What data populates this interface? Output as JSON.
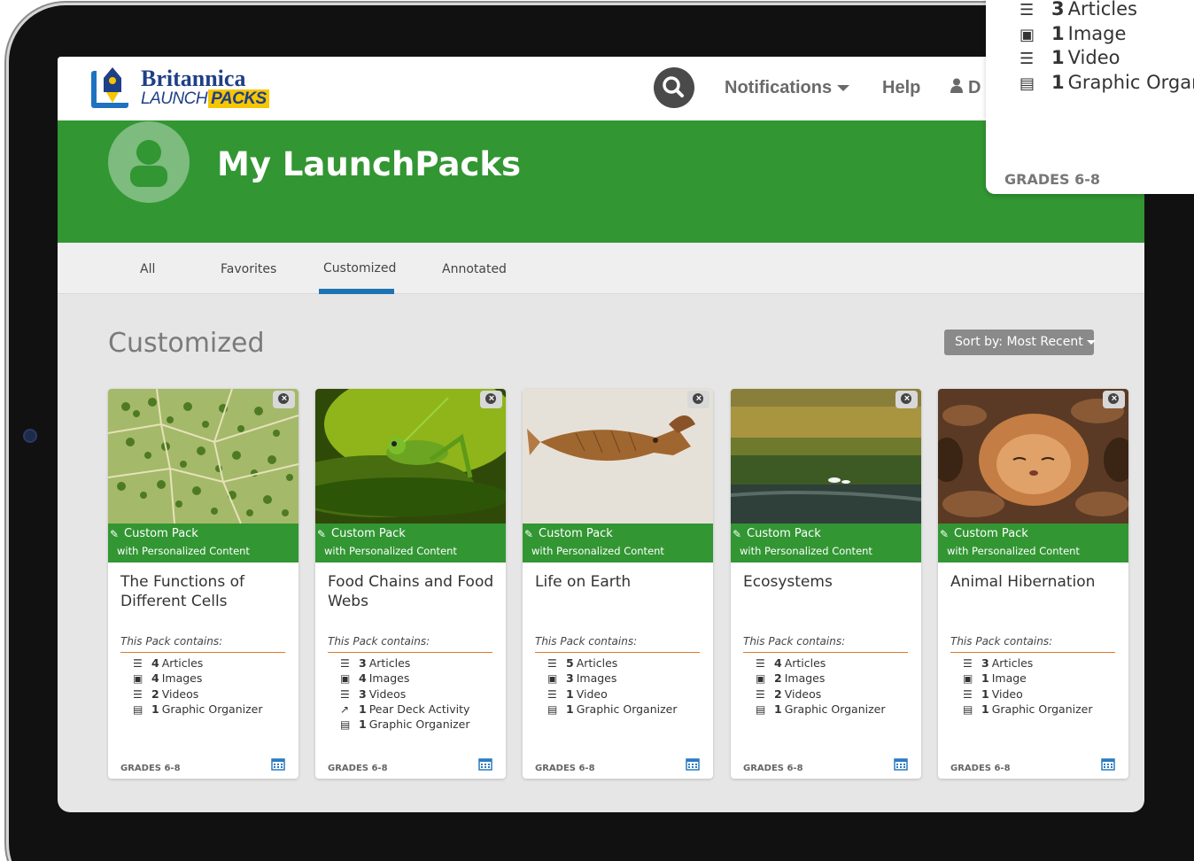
{
  "logo": {
    "line1": "Britannica",
    "line2a": "LAUNCH",
    "line2b": "PACKS"
  },
  "header": {
    "notifications_label": "Notifications",
    "help_label": "Help",
    "user_label": "D"
  },
  "banner": {
    "title": "My LaunchPacks"
  },
  "tabs": [
    {
      "label": "All"
    },
    {
      "label": "Favorites"
    },
    {
      "label": "Customized",
      "active": true
    },
    {
      "label": "Annotated"
    }
  ],
  "section": {
    "title": "Customized",
    "sort_label": "Sort by: Most Recent"
  },
  "custom_band": {
    "line1": "Custom Pack",
    "line2": "with Personalized Content"
  },
  "contains_label": "This Pack contains:",
  "cards": [
    {
      "title": "The Functions of Different Cells",
      "image": "plant-cells",
      "items": [
        {
          "icon": "list-icon",
          "count": "4",
          "label": "Articles"
        },
        {
          "icon": "image-icon",
          "count": "4",
          "label": "Images"
        },
        {
          "icon": "list-icon",
          "count": "2",
          "label": "Videos"
        },
        {
          "icon": "document-icon",
          "count": "1",
          "label": "Graphic Organizer"
        }
      ],
      "grades": "GRADES 6-8"
    },
    {
      "title": "Food Chains and Food Webs",
      "image": "grasshopper",
      "items": [
        {
          "icon": "list-icon",
          "count": "3",
          "label": "Articles"
        },
        {
          "icon": "image-icon",
          "count": "4",
          "label": "Images"
        },
        {
          "icon": "list-icon",
          "count": "3",
          "label": "Videos"
        },
        {
          "icon": "external-link-icon",
          "count": "1",
          "label": "Pear Deck Activity"
        },
        {
          "icon": "document-icon",
          "count": "1",
          "label": "Graphic Organizer"
        }
      ],
      "grades": "GRADES 6-8"
    },
    {
      "title": "Life on Earth",
      "image": "fish-fossil",
      "items": [
        {
          "icon": "list-icon",
          "count": "5",
          "label": "Articles"
        },
        {
          "icon": "image-icon",
          "count": "3",
          "label": "Images"
        },
        {
          "icon": "list-icon",
          "count": "1",
          "label": "Video"
        },
        {
          "icon": "document-icon",
          "count": "1",
          "label": "Graphic Organizer"
        }
      ],
      "grades": "GRADES 6-8"
    },
    {
      "title": "Ecosystems",
      "image": "wetland",
      "items": [
        {
          "icon": "list-icon",
          "count": "4",
          "label": "Articles"
        },
        {
          "icon": "image-icon",
          "count": "2",
          "label": "Images"
        },
        {
          "icon": "list-icon",
          "count": "2",
          "label": "Videos"
        },
        {
          "icon": "document-icon",
          "count": "1",
          "label": "Graphic Organizer"
        }
      ],
      "grades": "GRADES 6-8"
    },
    {
      "title": "Animal Hibernation",
      "image": "dormouse",
      "items": [
        {
          "icon": "list-icon",
          "count": "3",
          "label": "Articles"
        },
        {
          "icon": "image-icon",
          "count": "1",
          "label": "Image"
        },
        {
          "icon": "list-icon",
          "count": "1",
          "label": "Video"
        },
        {
          "icon": "document-icon",
          "count": "1",
          "label": "Graphic Organizer"
        }
      ],
      "grades": "GRADES 6-8"
    }
  ],
  "popover": {
    "items": [
      {
        "icon": "list-icon",
        "count": "3",
        "label": "Articles"
      },
      {
        "icon": "image-icon",
        "count": "1",
        "label": "Image"
      },
      {
        "icon": "list-icon",
        "count": "1",
        "label": "Video"
      },
      {
        "icon": "document-icon",
        "count": "1",
        "label": "Graphic Organi"
      }
    ],
    "grades": "GRADES 6-8"
  },
  "colors": {
    "brand_green": "#329633",
    "tab_active": "#1e74b3",
    "rule_orange": "#e07a2e",
    "logo_blue": "#1f3f87",
    "logo_yellow": "#f6c600"
  }
}
